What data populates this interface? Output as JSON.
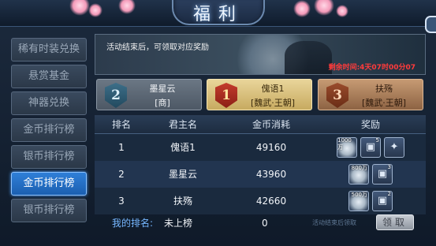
{
  "window": {
    "title": "福利"
  },
  "sidebar": {
    "items": [
      {
        "label": "稀有时装兑换",
        "active": false
      },
      {
        "label": "悬赏基金",
        "active": false
      },
      {
        "label": "神器兑换",
        "active": false
      },
      {
        "label": "金币排行榜",
        "active": false
      },
      {
        "label": "银币排行榜",
        "active": false
      },
      {
        "label": "金币排行榜",
        "active": true
      },
      {
        "label": "银币排行榜",
        "active": false
      }
    ]
  },
  "banner": {
    "note": "活动结束后，可领取对应奖励",
    "time": "剩余时间:4天07时00分07"
  },
  "podium": [
    {
      "rank": "2",
      "name": "墨星云",
      "faction": "[商]",
      "style": "gray"
    },
    {
      "rank": "1",
      "name": "傀语1",
      "faction": "[魏武·王朝]",
      "style": "gold"
    },
    {
      "rank": "3",
      "name": "扶殇",
      "faction": "[魏武·王朝]",
      "style": "bronze"
    }
  ],
  "table": {
    "headers": {
      "rank": "排名",
      "lord": "君主名",
      "coins": "金币消耗",
      "reward": "奖励"
    },
    "rows": [
      {
        "rank": "1",
        "name": "傀语1",
        "coins": "49160",
        "rewards": [
          {
            "icon": "silver-coin-icon",
            "qty": "1000万"
          },
          {
            "icon": "equipment-chest-icon",
            "qty": "5"
          },
          {
            "icon": "scroll-item-icon",
            "qty": ""
          }
        ]
      },
      {
        "rank": "2",
        "name": "墨星云",
        "coins": "43960",
        "rewards": [
          {
            "icon": "silver-coin-icon",
            "qty": "800万"
          },
          {
            "icon": "equipment-chest-icon",
            "qty": "3"
          }
        ]
      },
      {
        "rank": "3",
        "name": "扶殇",
        "coins": "42660",
        "rewards": [
          {
            "icon": "silver-coin-icon",
            "qty": "500万"
          },
          {
            "icon": "equipment-chest-icon",
            "qty": "2"
          }
        ]
      }
    ]
  },
  "my_rank": {
    "label": "我的排名:",
    "value": "未上榜",
    "coins": "0",
    "hint": "活动结束后领取",
    "claim_label": "领取"
  },
  "colors": {
    "accent": "#2f7fd8",
    "gold": "#e9d59a",
    "time_red": "#ff3b3b"
  }
}
